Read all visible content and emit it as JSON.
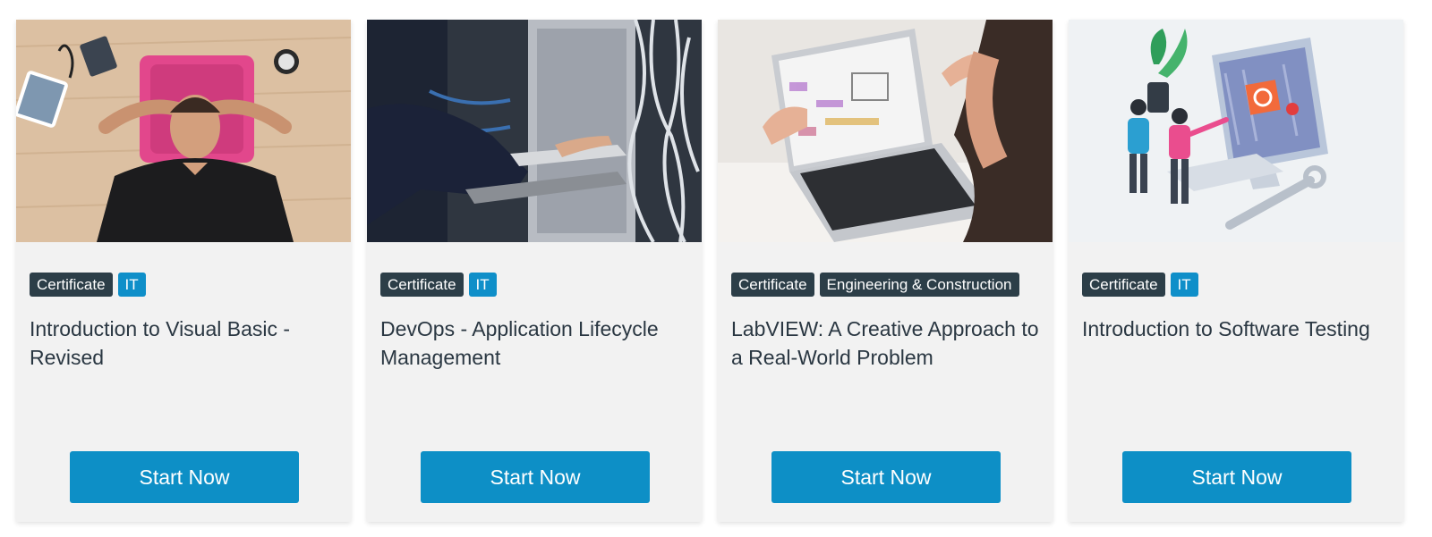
{
  "colors": {
    "card_background": "#f2f2f2",
    "badge_dark": "#2c3e48",
    "badge_blue": "#0f8fc9",
    "button": "#0d8fc6",
    "title_text": "#2a3742"
  },
  "cards": [
    {
      "image_subject": "man lying on floor with hands behind head",
      "badges": [
        "Certificate",
        "IT"
      ],
      "title": "Introduction to Visual Basic - Revised",
      "button_label": "Start Now"
    },
    {
      "image_subject": "person using laptop near server rack cables",
      "badges": [
        "Certificate",
        "IT"
      ],
      "title": "DevOps - Application Lifecycle Management",
      "button_label": "Start Now"
    },
    {
      "image_subject": "laptop showing LabVIEW block diagram with gesturing hands",
      "badges": [
        "Certificate",
        "Engineering & Construction"
      ],
      "title": "LabVIEW: A Creative Approach to a Real-World Problem",
      "button_label": "Start Now"
    },
    {
      "image_subject": "illustration of people testing software on monitor with bug and wrench",
      "badges": [
        "Certificate",
        "IT"
      ],
      "title": "Introduction to Software Testing",
      "button_label": "Start Now"
    }
  ]
}
